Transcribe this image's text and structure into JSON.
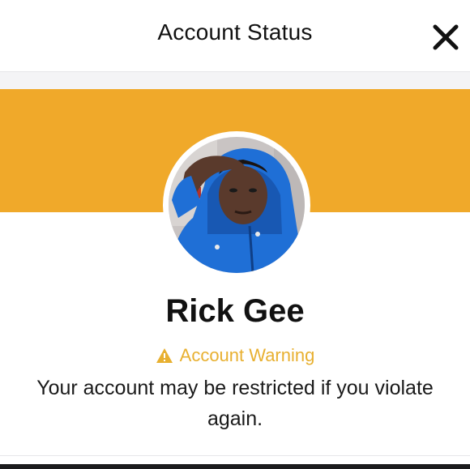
{
  "header": {
    "title": "Account Status",
    "close_icon": "close-icon"
  },
  "colors": {
    "banner": "#f0a92a",
    "warning": "#e8b030",
    "avatar_jacket": "#1f6fd6"
  },
  "profile": {
    "name": "Rick Gee",
    "avatar": "profile-photo"
  },
  "status": {
    "icon": "warning-icon",
    "label": "Account Warning",
    "message": "Your account may be restricted if you violate again."
  }
}
